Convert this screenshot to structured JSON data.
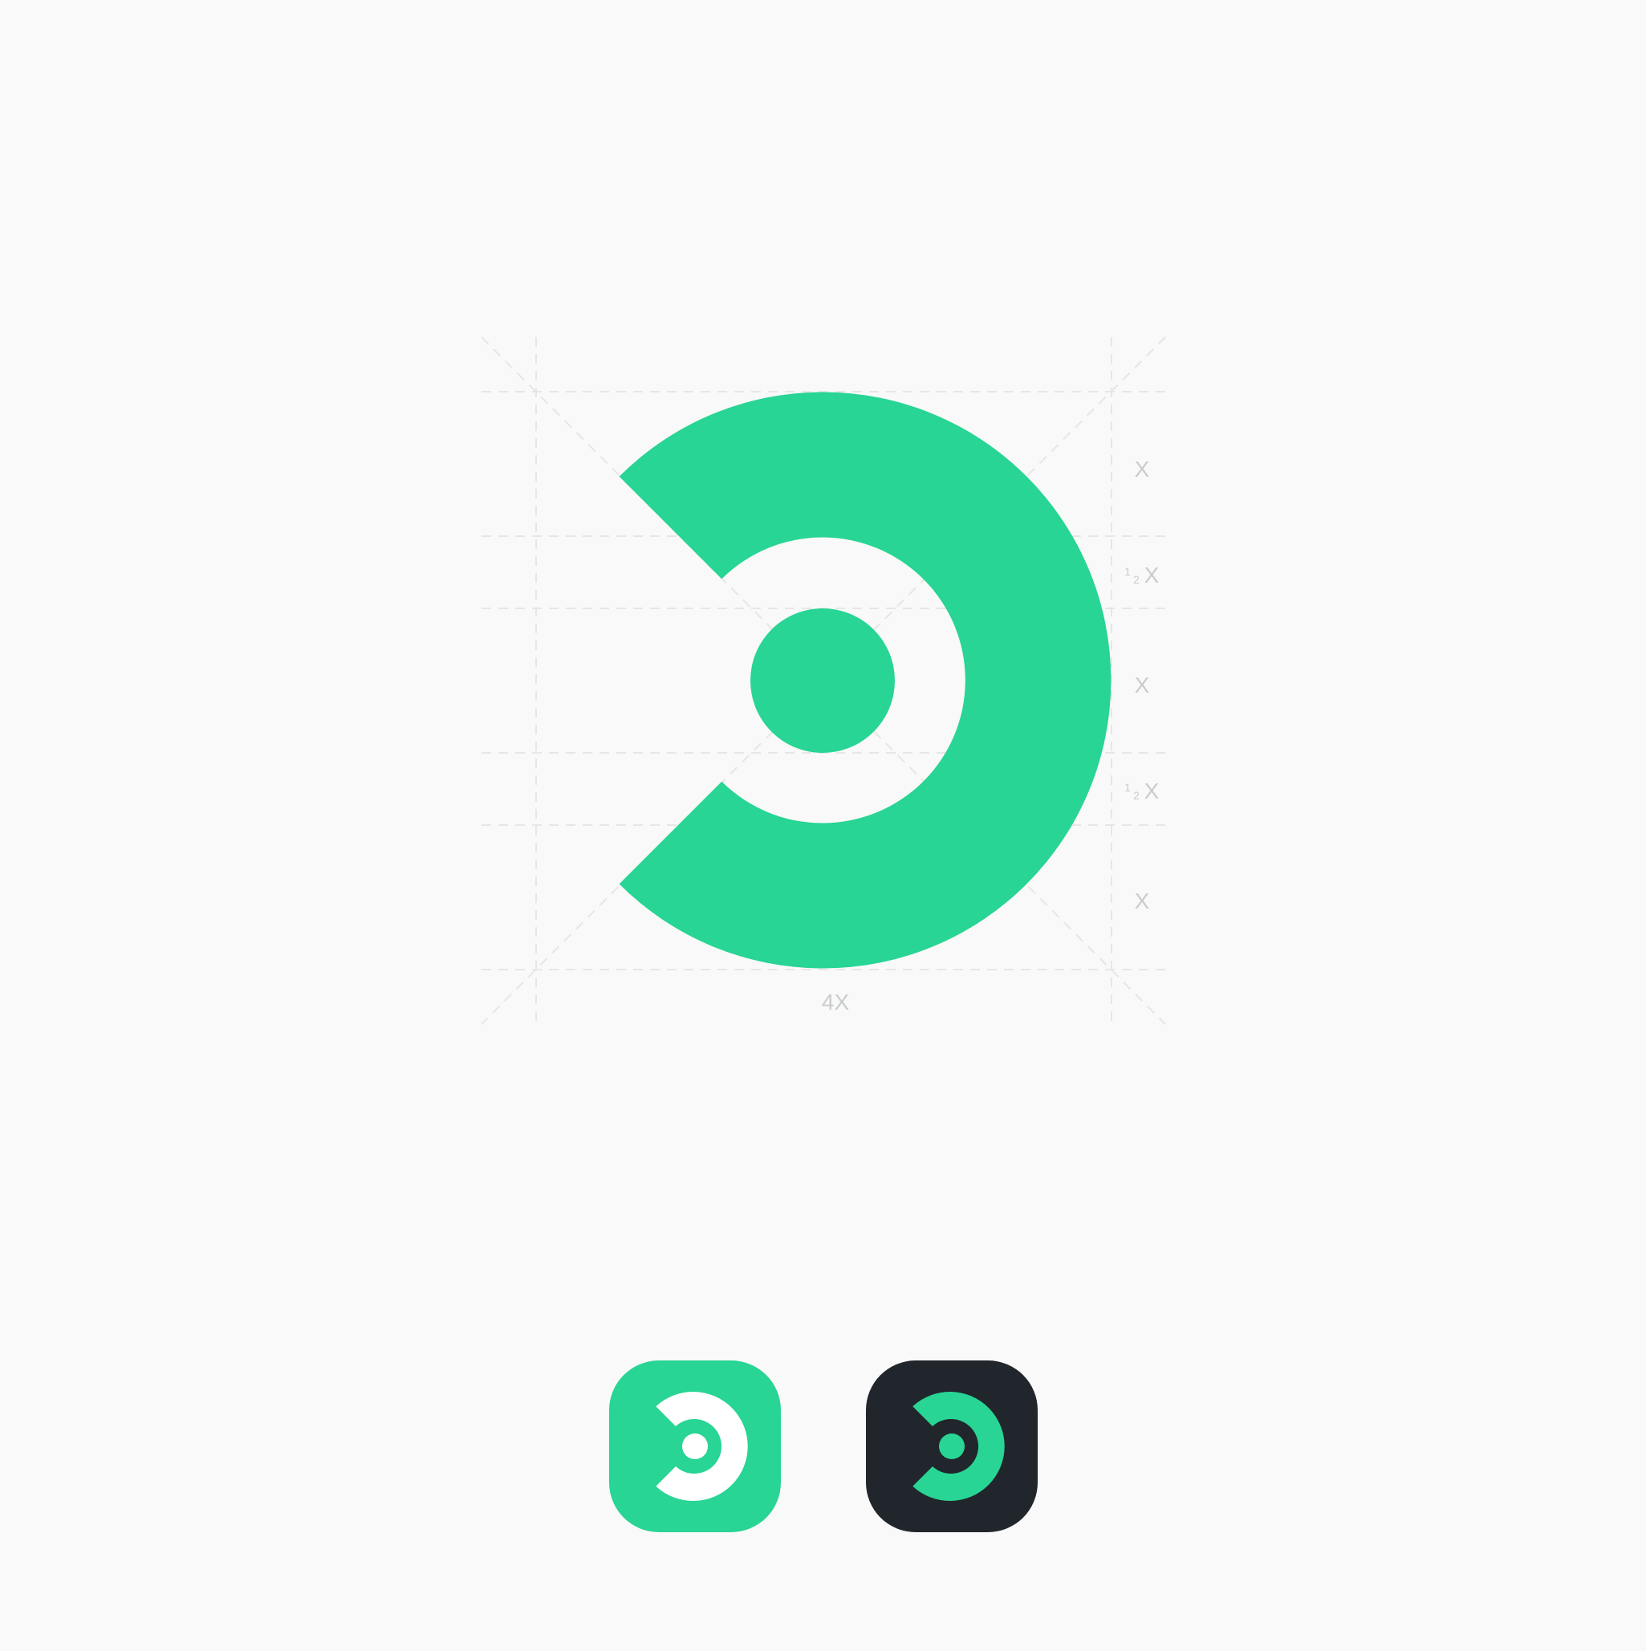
{
  "brand_colors": {
    "primary": "#28d594",
    "dark": "#21252c",
    "white": "#ffffff",
    "background": "#f9f9f9",
    "grid": "#e6e6e6",
    "label": "#c9cccf"
  },
  "construction": {
    "unit_labels": {
      "x": "X",
      "half_numerator": "1",
      "half_denominator": "2",
      "width_total": "4X"
    }
  },
  "app_icons": [
    {
      "name": "app-icon-green",
      "tile_color": "#28d594",
      "mark_color": "#ffffff"
    },
    {
      "name": "app-icon-dark",
      "tile_color": "#21252c",
      "mark_color": "#28d594"
    }
  ],
  "icons": [
    "logo-mark",
    "app-icon-green",
    "app-icon-dark"
  ]
}
